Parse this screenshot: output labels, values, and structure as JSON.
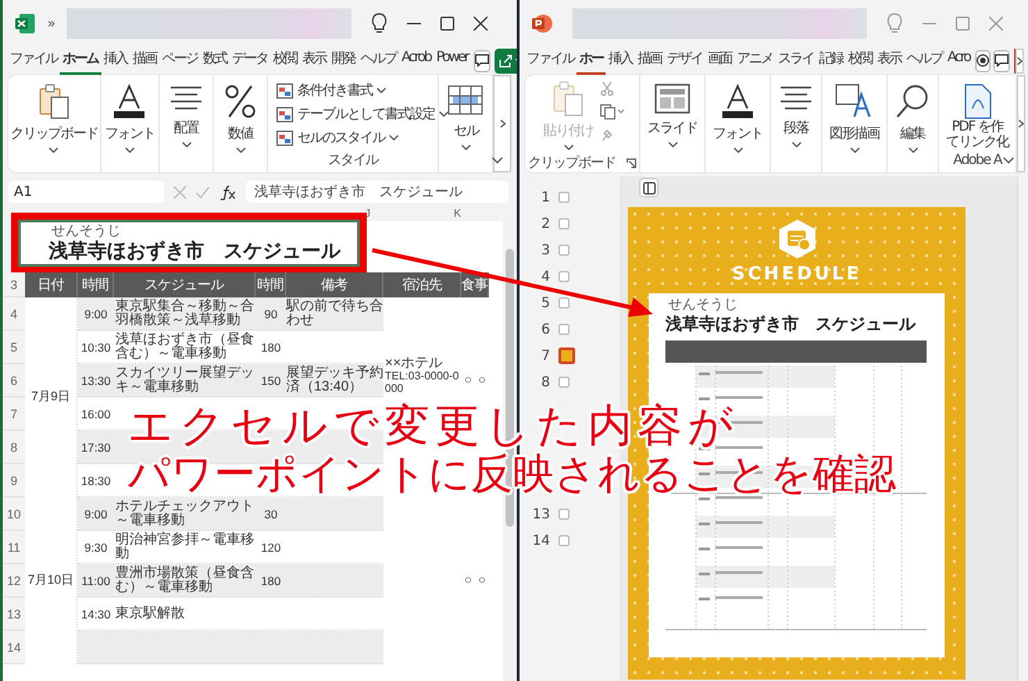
{
  "excel": {
    "chevron": "»",
    "tabs": [
      {
        "label": "ファイル",
        "selected": false
      },
      {
        "label": "ホーム",
        "selected": true
      },
      {
        "label": "挿入",
        "selected": false
      },
      {
        "label": "描画",
        "selected": false
      },
      {
        "label": "ページ",
        "selected": false
      },
      {
        "label": "数式",
        "selected": false
      },
      {
        "label": "データ",
        "selected": false
      },
      {
        "label": "校閲",
        "selected": false
      },
      {
        "label": "表示",
        "selected": false
      },
      {
        "label": "開発",
        "selected": false
      },
      {
        "label": "ヘルプ",
        "selected": false
      },
      {
        "label": "Acrob",
        "selected": false
      },
      {
        "label": "Power",
        "selected": false
      }
    ],
    "ribbon": [
      {
        "kind": "clipboard",
        "label": "クリップボード"
      },
      {
        "kind": "font",
        "label": "フォント"
      },
      {
        "kind": "align",
        "label": "配置"
      },
      {
        "kind": "percent",
        "label": "数値"
      },
      {
        "kind": "styles",
        "label": "スタイル",
        "items": [
          "条件付き書式",
          "テーブルとして書式設定",
          "セルのスタイル"
        ]
      },
      {
        "kind": "cells",
        "label": "セル"
      }
    ],
    "name_box": "A1",
    "formula": "浅草寺ほおずき市　スケジュール",
    "columns": [
      "J",
      "K"
    ],
    "title_ruby": "せんそうじ",
    "title": "浅草寺ほおずき市　スケジュール",
    "header_row": "3",
    "headers": [
      "日付",
      "時間",
      "スケジュール",
      "時間",
      "備考",
      "宿泊先",
      "食事"
    ],
    "days": [
      {
        "date": "7月9日",
        "hotel": [
          "××ホテル",
          "TEL:03-0000-0000"
        ],
        "meals": [
          "○",
          "○"
        ],
        "rows": [
          {
            "number": "4",
            "shaded": true,
            "time": "9:00",
            "schedule": "東京駅集合～移動～合羽橋散策～浅草移動",
            "duration": "90",
            "note": "駅の前で待ち合わせ"
          },
          {
            "number": "5",
            "shaded": false,
            "time": "10:30",
            "schedule": "浅草ほおずき市（昼食含む）～電車移動",
            "duration": "180"
          },
          {
            "number": "6",
            "shaded": true,
            "time": "13:30",
            "schedule": "スカイツリー展望デッキ～電車移動",
            "duration": "150",
            "note": "展望デッキ予約済（13:40）"
          },
          {
            "number": "7",
            "shaded": false,
            "time": "16:00"
          },
          {
            "number": "8",
            "shaded": true,
            "time": "17:30"
          },
          {
            "number": "9",
            "shaded": false,
            "time": "18:30"
          }
        ]
      },
      {
        "date": "7月10日",
        "meals": [
          "○",
          "○"
        ],
        "rows": [
          {
            "number": "10",
            "shaded": true,
            "time": "9:00",
            "schedule": "ホテルチェックアウト～電車移動",
            "duration": "30"
          },
          {
            "number": "11",
            "shaded": false,
            "time": "9:30",
            "schedule": "明治神宮参拝～電車移動",
            "duration": "120"
          },
          {
            "number": "12",
            "shaded": true,
            "time": "11:00",
            "schedule": "豊洲市場散策（昼食含む）～電車移動",
            "duration": "180"
          },
          {
            "number": "13",
            "shaded": false,
            "time": "14:30",
            "schedule": "東京駅解散"
          },
          {
            "number": "14",
            "shaded": true
          }
        ]
      }
    ]
  },
  "powerpoint": {
    "tabs": [
      {
        "label": "ファイル",
        "selected": false
      },
      {
        "label": "ホー",
        "selected": true
      },
      {
        "label": "挿入",
        "selected": false
      },
      {
        "label": "描画",
        "selected": false
      },
      {
        "label": "デザイ",
        "selected": false
      },
      {
        "label": "画面",
        "selected": false
      },
      {
        "label": "アニメ",
        "selected": false
      },
      {
        "label": "スライ",
        "selected": false
      },
      {
        "label": "記録",
        "selected": false
      },
      {
        "label": "校閲",
        "selected": false
      },
      {
        "label": "表示",
        "selected": false
      },
      {
        "label": "ヘルプ",
        "selected": false
      },
      {
        "label": "Acro",
        "selected": false
      }
    ],
    "ribbon": [
      {
        "kind": "clipboard",
        "label": "クリップボード",
        "paste": "貼り付け",
        "disabled": true
      },
      {
        "kind": "slide",
        "label": "スライド"
      },
      {
        "kind": "font",
        "label": "フォント"
      },
      {
        "kind": "align",
        "label": "段落"
      },
      {
        "kind": "shapes",
        "label": "図形描画"
      },
      {
        "kind": "search",
        "label": "編集"
      },
      {
        "kind": "pdf",
        "lines": [
          "PDF を作",
          "てリンク化"
        ],
        "label": "Adobe A"
      }
    ],
    "slides": [
      {
        "number": "1",
        "selected": false
      },
      {
        "number": "2",
        "selected": false
      },
      {
        "number": "3",
        "selected": false
      },
      {
        "number": "4",
        "selected": false
      },
      {
        "number": "5",
        "selected": false
      },
      {
        "number": "6",
        "selected": false
      },
      {
        "number": "7",
        "selected": true
      },
      {
        "number": "8",
        "selected": false
      },
      {
        "number": "13",
        "selected": false
      },
      {
        "number": "14",
        "selected": false
      }
    ],
    "slide": {
      "heading": "SCHEDULE",
      "title_ruby": "せんそうじ",
      "title": "浅草寺ほおずき市　スケジュール"
    }
  },
  "caption": [
    "エクセルで変更した内容が",
    "パワーポイントに反映されることを確認"
  ]
}
